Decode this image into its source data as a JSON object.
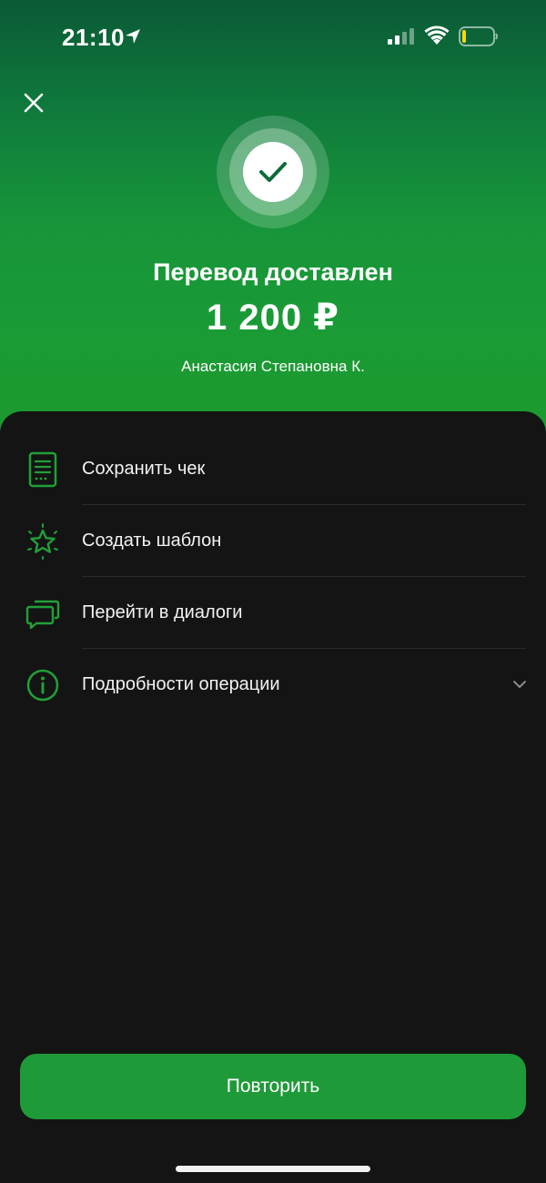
{
  "status_bar": {
    "time": "21:10"
  },
  "result": {
    "title": "Перевод доставлен",
    "amount": "1 200 ₽",
    "recipient": "Анастасия Степановна К."
  },
  "actions": [
    {
      "label": "Сохранить чек",
      "icon": "receipt-icon"
    },
    {
      "label": "Создать шаблон",
      "icon": "star-icon"
    },
    {
      "label": "Перейти в диалоги",
      "icon": "chat-icon"
    },
    {
      "label": "Подробности операции",
      "icon": "info-icon"
    }
  ],
  "repeat_button": {
    "label": "Повторить"
  },
  "colors": {
    "accent": "#1f9a38",
    "icon_green": "#21a038",
    "background": "#141414"
  }
}
